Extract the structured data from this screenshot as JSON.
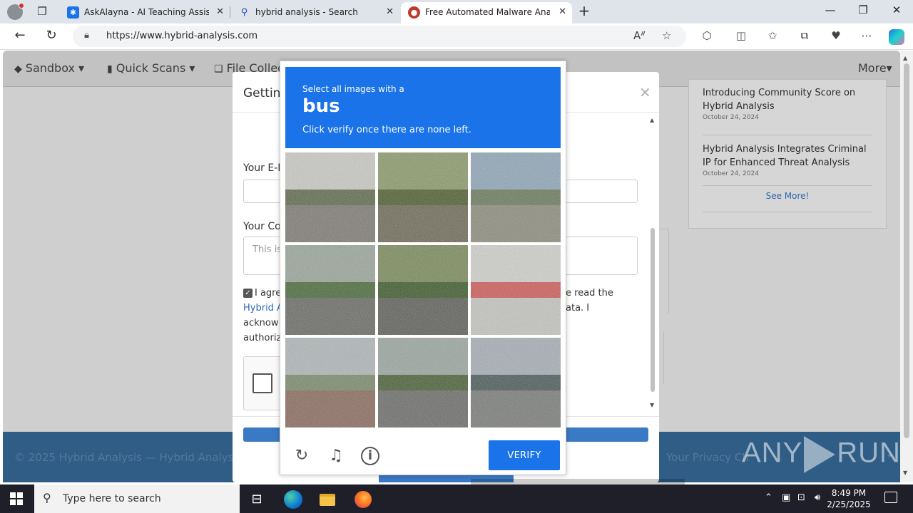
{
  "browser": {
    "tabs": [
      {
        "title": "AskAlayna - AI Teaching Assistant",
        "icon": "star-icon",
        "color": "#1a73e8"
      },
      {
        "title": "hybrid analysis - Search",
        "icon": "search-icon",
        "color": "#ffffff"
      },
      {
        "title": "Free Automated Malware Analysis",
        "icon": "hybrid-analysis-icon",
        "color": "#c0392b"
      }
    ],
    "url": "https://www.hybrid-analysis.com"
  },
  "site": {
    "nav": [
      {
        "label": "Sandbox",
        "icon": "cube-icon"
      },
      {
        "label": "Quick Scans",
        "icon": "file-icon"
      },
      {
        "label": "File Collec",
        "icon": "files-icon"
      }
    ],
    "more_label": "More",
    "news": [
      {
        "title": "Introducing Community Score on Hybrid Analysis",
        "date": "October 24, 2024"
      },
      {
        "title": "Hybrid Analysis Integrates Criminal IP for Enhanced Threat Analysis",
        "date": "October 24, 2024"
      }
    ],
    "see_more": "See More!",
    "footer_copy": "© 2025 Hybrid Analysis — Hybrid Analysis",
    "footer_privacy": "Your Privacy Ch"
  },
  "modal": {
    "title": "Gettin",
    "email_label": "Your E-M",
    "comment_label": "Your Co",
    "comment_placeholder": "This is",
    "agree_line1": "I agre",
    "agree_line1_end": "e read the",
    "agree_link": "Hybrid A",
    "agree_line2_end": "ata. I",
    "agree_line3": "acknow",
    "agree_line4": "authoriz"
  },
  "captcha": {
    "prompt_line1": "Select all images with a",
    "target": "bus",
    "prompt_line3": "Click verify once there are none left.",
    "verify_label": "VERIFY",
    "tiles": [
      {
        "name": "tile-street-trucks",
        "sky": "#c9c9c4",
        "ground": "#7d7a72",
        "mid": "#5f6a4c"
      },
      {
        "name": "tile-bus-stop-park",
        "sky": "#8a9a6a",
        "ground": "#6e6a58",
        "mid": "#4e5e2e"
      },
      {
        "name": "tile-open-field",
        "sky": "#8fa6b8",
        "ground": "#8c8d7c",
        "mid": "#6a7a5c"
      },
      {
        "name": "tile-traffic-lights-car",
        "sky": "#9aa59a",
        "ground": "#6a6a66",
        "mid": "#4a6a3a"
      },
      {
        "name": "tile-road-trees",
        "sky": "#7a8a5a",
        "ground": "#5e5e5a",
        "mid": "#3e5a2a"
      },
      {
        "name": "tile-fire-hydrant",
        "sky": "#d0d0cc",
        "ground": "#c4c4c0",
        "mid": "#cf5a5a"
      },
      {
        "name": "tile-bike-path",
        "sky": "#b0b6b8",
        "ground": "#8a6a5e",
        "mid": "#7a8a6a"
      },
      {
        "name": "tile-street-parked-cars",
        "sky": "#9aa6a0",
        "ground": "#6c6c6a",
        "mid": "#4a6036"
      },
      {
        "name": "tile-lakeside-road",
        "sky": "#a6aeb4",
        "ground": "#7a7c78",
        "mid": "#4a5a5a"
      }
    ]
  },
  "taskbar": {
    "search_placeholder": "Type here to search",
    "time": "8:49 PM",
    "date": "2/25/2025"
  },
  "watermark": {
    "left": "ANY",
    "right": "RUN"
  }
}
